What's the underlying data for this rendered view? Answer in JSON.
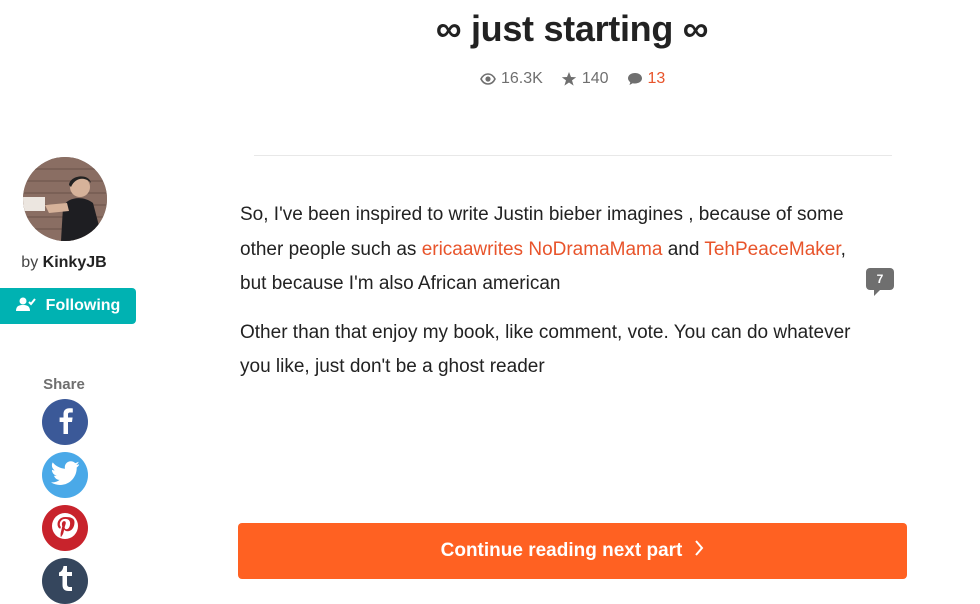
{
  "story": {
    "title": "∞ just starting ∞",
    "stats": {
      "reads": "16.3K",
      "votes": "140",
      "comments": "13"
    }
  },
  "author": {
    "by_label": "by",
    "name": "KinkyJB",
    "follow_label": "Following"
  },
  "share": {
    "label": "Share",
    "buttons": [
      "facebook-icon",
      "twitter-icon",
      "pinterest-icon",
      "tumblr-icon"
    ]
  },
  "content": {
    "p1_a": "So, I've been inspired to write Justin bieber imagines , because of some other people such as ",
    "link1": "ericaawrites",
    "space": " ",
    "link2": "NoDramaMama",
    "p1_b": " and ",
    "link3": "TehPeaceMaker",
    "p1_c": ", but because I'm also African american",
    "p2": "Other than that enjoy my book, like comment, vote. You can do whatever you like, just don't be a ghost reader",
    "inline_comment_count": "7"
  },
  "continue_button": {
    "label": "Continue reading next part"
  },
  "colors": {
    "accent": "#ff6122",
    "link": "#e8542b",
    "follow": "#00b2b2"
  }
}
